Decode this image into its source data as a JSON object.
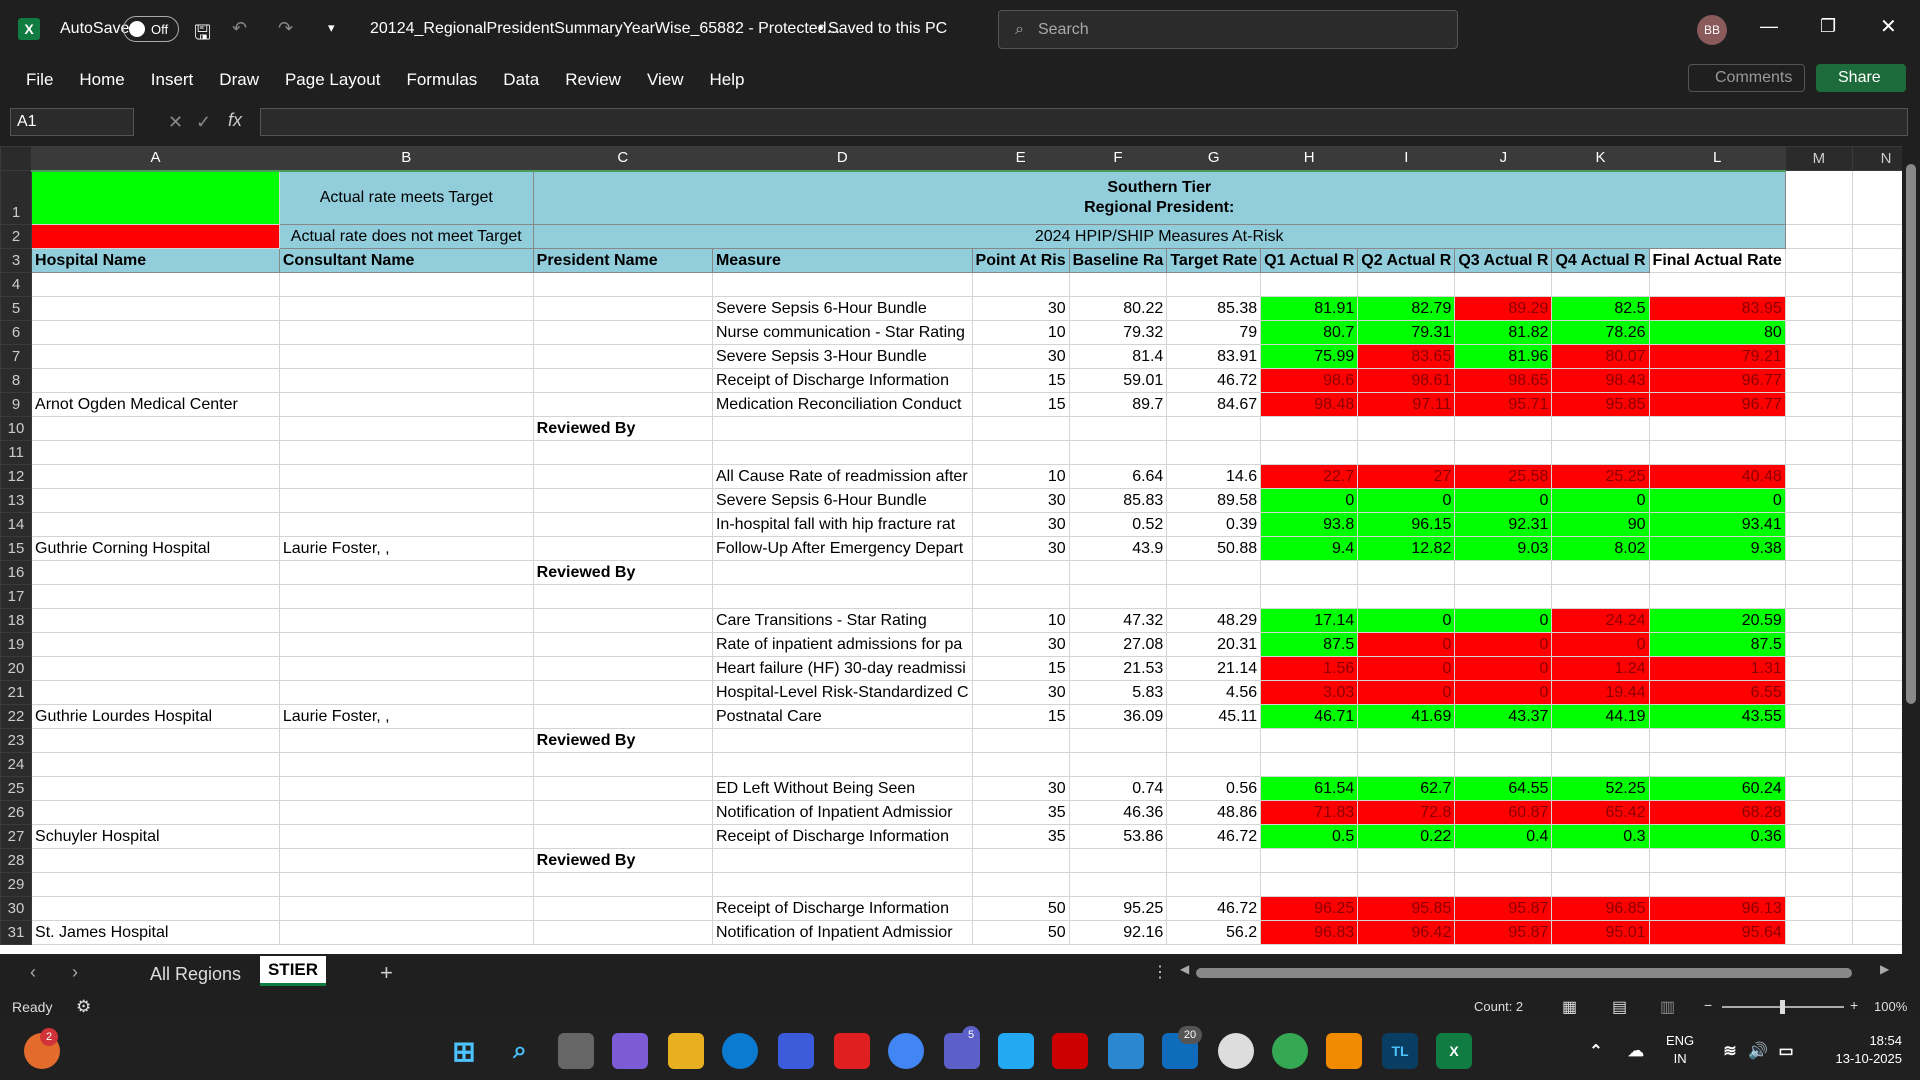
{
  "titlebar": {
    "autosave_label": "AutoSave",
    "toggle_state": "Off",
    "doc_title": "20124_RegionalPresidentSummaryYearWise_65882  -  Protected...",
    "save_status": "•  Saved to this PC",
    "search_placeholder": "Search",
    "avatar": "BB",
    "app_icon_letter": "X"
  },
  "ribbon": {
    "tabs": [
      "File",
      "Home",
      "Insert",
      "Draw",
      "Page Layout",
      "Formulas",
      "Data",
      "Review",
      "View",
      "Help"
    ],
    "comments": "Comments",
    "share": "Share"
  },
  "formula_bar": {
    "name_box": "A1",
    "formula": ""
  },
  "columns": [
    "A",
    "B",
    "C",
    "D",
    "E",
    "F",
    "G",
    "H",
    "I",
    "J",
    "K",
    "L",
    "M",
    "N"
  ],
  "header": {
    "legend_green": "",
    "legend_meets": "Actual rate meets Target",
    "legend_not_meet": "Actual rate does not meet Target",
    "region": "Southern Tier",
    "president_label": "Regional President:",
    "measures_title": "2024 HPIP/SHIP Measures At-Risk",
    "cols": [
      "Hospital Name",
      "Consultant Name",
      "President Name",
      "Measure",
      "Point At Ris",
      "Baseline Ra",
      "Target Rate",
      "Q1 Actual R",
      "Q2 Actual R",
      "Q3 Actual R",
      "Q4 Actual R",
      "Final Actual Rate"
    ]
  },
  "reviewed_by": "Reviewed By",
  "hospitals": [
    {
      "name": "Arnot Ogden Medical Center",
      "consultant": "",
      "measures": [
        {
          "m": "Severe Sepsis 6-Hour Bundle",
          "p": "30",
          "b": "80.22",
          "t": "85.38",
          "q": [
            "81.91",
            "82.79",
            "89.29",
            "82.5",
            "83.95"
          ],
          "c": [
            "g",
            "g",
            "r",
            "g",
            "r"
          ]
        },
        {
          "m": "Nurse communication - Star Rating",
          "p": "10",
          "b": "79.32",
          "t": "79",
          "q": [
            "80.7",
            "79.31",
            "81.82",
            "78.26",
            "80"
          ],
          "c": [
            "g",
            "g",
            "g",
            "g",
            "g"
          ]
        },
        {
          "m": "Severe Sepsis 3-Hour Bundle",
          "p": "30",
          "b": "81.4",
          "t": "83.91",
          "q": [
            "75.99",
            "83.65",
            "81.96",
            "80.07",
            "79.21"
          ],
          "c": [
            "g",
            "r",
            "g",
            "r",
            "r"
          ]
        },
        {
          "m": "Receipt of Discharge Information",
          "p": "15",
          "b": "59.01",
          "t": "46.72",
          "q": [
            "98.6",
            "98.61",
            "98.65",
            "98.43",
            "96.77"
          ],
          "c": [
            "r",
            "r",
            "r",
            "r",
            "r"
          ]
        },
        {
          "m": "Medication Reconciliation Conduct",
          "p": "15",
          "b": "89.7",
          "t": "84.67",
          "q": [
            "98.48",
            "97.11",
            "95.71",
            "95.85",
            "96.77"
          ],
          "c": [
            "r",
            "r",
            "r",
            "r",
            "r"
          ]
        }
      ]
    },
    {
      "name": "Guthrie Corning Hospital",
      "consultant": "Laurie Foster, ,",
      "measures": [
        {
          "m": "All Cause Rate of readmission after",
          "p": "10",
          "b": "6.64",
          "t": "14.6",
          "q": [
            "22.7",
            "27",
            "25.58",
            "25.25",
            "40.48"
          ],
          "c": [
            "r",
            "r",
            "r",
            "r",
            "r"
          ]
        },
        {
          "m": "Severe Sepsis 6-Hour Bundle",
          "p": "30",
          "b": "85.83",
          "t": "89.58",
          "q": [
            "0",
            "0",
            "0",
            "0",
            "0"
          ],
          "c": [
            "g",
            "g",
            "g",
            "g",
            "g"
          ]
        },
        {
          "m": "In-hospital fall with hip fracture rat",
          "p": "30",
          "b": "0.52",
          "t": "0.39",
          "q": [
            "93.8",
            "96.15",
            "92.31",
            "90",
            "93.41"
          ],
          "c": [
            "g",
            "g",
            "g",
            "g",
            "g"
          ]
        },
        {
          "m": "Follow-Up After Emergency Depart",
          "p": "30",
          "b": "43.9",
          "t": "50.88",
          "q": [
            "9.4",
            "12.82",
            "9.03",
            "8.02",
            "9.38"
          ],
          "c": [
            "g",
            "g",
            "g",
            "g",
            "g"
          ]
        }
      ]
    },
    {
      "name": "Guthrie Lourdes Hospital",
      "consultant": "Laurie Foster, ,",
      "measures": [
        {
          "m": "Care Transitions - Star Rating",
          "p": "10",
          "b": "47.32",
          "t": "48.29",
          "q": [
            "17.14",
            "0",
            "0",
            "24.24",
            "20.59"
          ],
          "c": [
            "g",
            "g",
            "g",
            "r",
            "g"
          ]
        },
        {
          "m": "Rate of inpatient admissions for pa",
          "p": "30",
          "b": "27.08",
          "t": "20.31",
          "q": [
            "87.5",
            "0",
            "0",
            "0",
            "87.5"
          ],
          "c": [
            "g",
            "r",
            "r",
            "r",
            "g"
          ]
        },
        {
          "m": "Heart failure (HF) 30-day readmissi",
          "p": "15",
          "b": "21.53",
          "t": "21.14",
          "q": [
            "1.56",
            "0",
            "0",
            "1.24",
            "1.31"
          ],
          "c": [
            "r",
            "r",
            "r",
            "r",
            "r"
          ]
        },
        {
          "m": "Hospital-Level Risk-Standardized C",
          "p": "30",
          "b": "5.83",
          "t": "4.56",
          "q": [
            "3.03",
            "0",
            "0",
            "19.44",
            "6.55"
          ],
          "c": [
            "r",
            "r",
            "r",
            "r",
            "r"
          ]
        },
        {
          "m": "Postnatal Care",
          "p": "15",
          "b": "36.09",
          "t": "45.11",
          "q": [
            "46.71",
            "41.69",
            "43.37",
            "44.19",
            "43.55"
          ],
          "c": [
            "g",
            "g",
            "g",
            "g",
            "g"
          ]
        }
      ]
    },
    {
      "name": "Schuyler Hospital",
      "consultant": "",
      "measures": [
        {
          "m": "ED Left Without Being Seen",
          "p": "30",
          "b": "0.74",
          "t": "0.56",
          "q": [
            "61.54",
            "62.7",
            "64.55",
            "52.25",
            "60.24"
          ],
          "c": [
            "g",
            "g",
            "g",
            "g",
            "g"
          ]
        },
        {
          "m": "Notification of Inpatient Admissior",
          "p": "35",
          "b": "46.36",
          "t": "48.86",
          "q": [
            "71.83",
            "72.8",
            "60.87",
            "65.42",
            "68.28"
          ],
          "c": [
            "r",
            "r",
            "r",
            "r",
            "r"
          ]
        },
        {
          "m": "Receipt of Discharge Information",
          "p": "35",
          "b": "53.86",
          "t": "46.72",
          "q": [
            "0.5",
            "0.22",
            "0.4",
            "0.3",
            "0.36"
          ],
          "c": [
            "g",
            "g",
            "g",
            "g",
            "g"
          ]
        }
      ]
    },
    {
      "name": "St. James Hospital",
      "consultant": "",
      "measures": [
        {
          "m": "Receipt of Discharge Information",
          "p": "50",
          "b": "95.25",
          "t": "46.72",
          "q": [
            "96.25",
            "95.85",
            "95.87",
            "96.85",
            "96.13"
          ],
          "c": [
            "r",
            "r",
            "r",
            "r",
            "r"
          ]
        },
        {
          "m": "Notification of Inpatient Admissior",
          "p": "50",
          "b": "92.16",
          "t": "56.2",
          "q": [
            "96.83",
            "96.42",
            "95.87",
            "95.01",
            "95.64"
          ],
          "c": [
            "r",
            "r",
            "r",
            "r",
            "r"
          ]
        }
      ]
    }
  ],
  "sheet_tabs": [
    "All Regions",
    "STIER"
  ],
  "status": {
    "ready": "Ready",
    "count": "Count: 2",
    "zoom": "100%"
  },
  "taskbar": {
    "lang1": "ENG",
    "lang2": "IN",
    "time": "18:54",
    "date": "13-10-2025",
    "badge_browser": "2",
    "badge_teams": "5",
    "badge_mail": "20"
  }
}
